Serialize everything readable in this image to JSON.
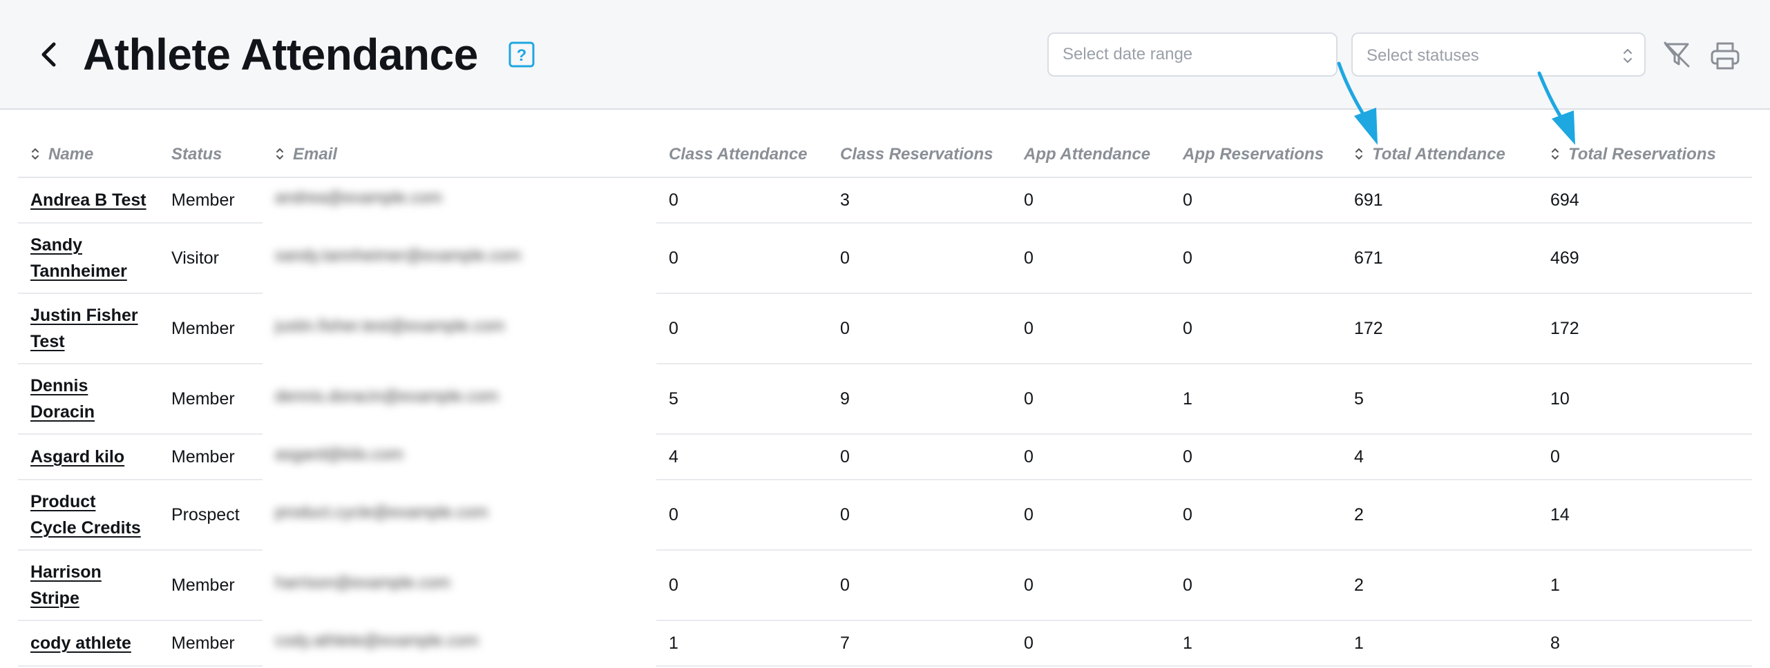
{
  "header": {
    "title": "Athlete Attendance",
    "date_placeholder": "Select date range",
    "status_placeholder": "Select statuses",
    "icons": {
      "back": "chevron-left-icon",
      "help": "question-square-icon",
      "filter_clear": "filter-off-icon",
      "print": "printer-icon"
    },
    "accent_color": "#1ea7e1"
  },
  "table": {
    "columns": {
      "name": "Name",
      "status": "Status",
      "email": "Email",
      "class_attendance": "Class Attendance",
      "class_reservations": "Class Reservations",
      "app_attendance": "App Attendance",
      "app_reservations": "App Reservations",
      "total_attendance": "Total Attendance",
      "total_reservations": "Total Reservations"
    },
    "rows": [
      {
        "name": "Andrea B Test",
        "status": "Member",
        "email": "andrea@example.com",
        "class_attendance": "0",
        "class_reservations": "3",
        "app_attendance": "0",
        "app_reservations": "0",
        "total_attendance": "691",
        "total_reservations": "694"
      },
      {
        "name": "Sandy Tannheimer",
        "status": "Visitor",
        "email": "sandy.tannheimer@example.com",
        "class_attendance": "0",
        "class_reservations": "0",
        "app_attendance": "0",
        "app_reservations": "0",
        "total_attendance": "671",
        "total_reservations": "469"
      },
      {
        "name": "Justin Fisher Test",
        "status": "Member",
        "email": "justin.fisher.test@example.com",
        "class_attendance": "0",
        "class_reservations": "0",
        "app_attendance": "0",
        "app_reservations": "0",
        "total_attendance": "172",
        "total_reservations": "172"
      },
      {
        "name": "Dennis Doracin",
        "status": "Member",
        "email": "dennis.doracin@example.com",
        "class_attendance": "5",
        "class_reservations": "9",
        "app_attendance": "0",
        "app_reservations": "1",
        "total_attendance": "5",
        "total_reservations": "10"
      },
      {
        "name": "Asgard kilo",
        "status": "Member",
        "email": "asgard@kilo.com",
        "class_attendance": "4",
        "class_reservations": "0",
        "app_attendance": "0",
        "app_reservations": "0",
        "total_attendance": "4",
        "total_reservations": "0"
      },
      {
        "name": "Product Cycle Credits",
        "status": "Prospect",
        "email": "product.cycle@example.com",
        "class_attendance": "0",
        "class_reservations": "0",
        "app_attendance": "0",
        "app_reservations": "0",
        "total_attendance": "2",
        "total_reservations": "14"
      },
      {
        "name": "Harrison Stripe",
        "status": "Member",
        "email": "harrison@example.com",
        "class_attendance": "0",
        "class_reservations": "0",
        "app_attendance": "0",
        "app_reservations": "0",
        "total_attendance": "2",
        "total_reservations": "1"
      },
      {
        "name": "cody athlete",
        "status": "Member",
        "email": "cody.athlete@example.com",
        "class_attendance": "1",
        "class_reservations": "7",
        "app_attendance": "0",
        "app_reservations": "1",
        "total_attendance": "1",
        "total_reservations": "8"
      }
    ]
  }
}
